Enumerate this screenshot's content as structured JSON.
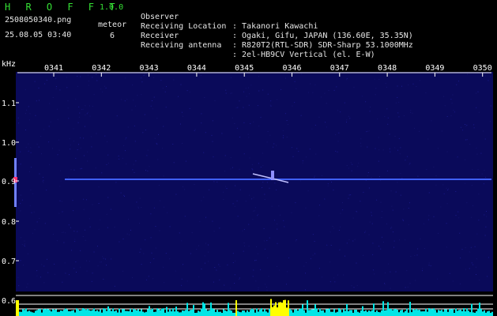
{
  "header": {
    "app_name": "H R O F F T",
    "app_version": "1.0.0",
    "file_name": "2508050340.png",
    "date_time": "25.08.05 03:40",
    "meteor_label": "meteor",
    "meteor_count": "6"
  },
  "info": [
    {
      "key": "Observer",
      "value": ": Takanori Kawachi"
    },
    {
      "key": "Receiving Location",
      "value": ": Ogaki, Gifu, JAPAN (136.60E, 35.35N)"
    },
    {
      "key": "Receiver",
      "value": ": R820T2(RTL-SDR) SDR-Sharp 53.1000MHz"
    },
    {
      "key": "Receiving antenna",
      "value": ": 2el-HB9CV Vertical (el. E-W)"
    }
  ],
  "axes": {
    "y_unit": "kHz",
    "y_ticks": [
      "1.1",
      "1.0",
      "0.9",
      "0.8",
      "0.7",
      "0.6"
    ],
    "x_ticks": [
      "0341",
      "0342",
      "0343",
      "0344",
      "0345",
      "0346",
      "0347",
      "0348",
      "0349",
      "0350"
    ]
  },
  "colors": {
    "background": "#000000",
    "waterfall": "#0a0a5a",
    "carrier": "#4060ff",
    "meteor_hit": "#ff3070",
    "axis": "#ffffff",
    "title_green": "#35e035",
    "bottom_trace": "#00e6e6",
    "trace_highlight": "#ffff00"
  }
}
